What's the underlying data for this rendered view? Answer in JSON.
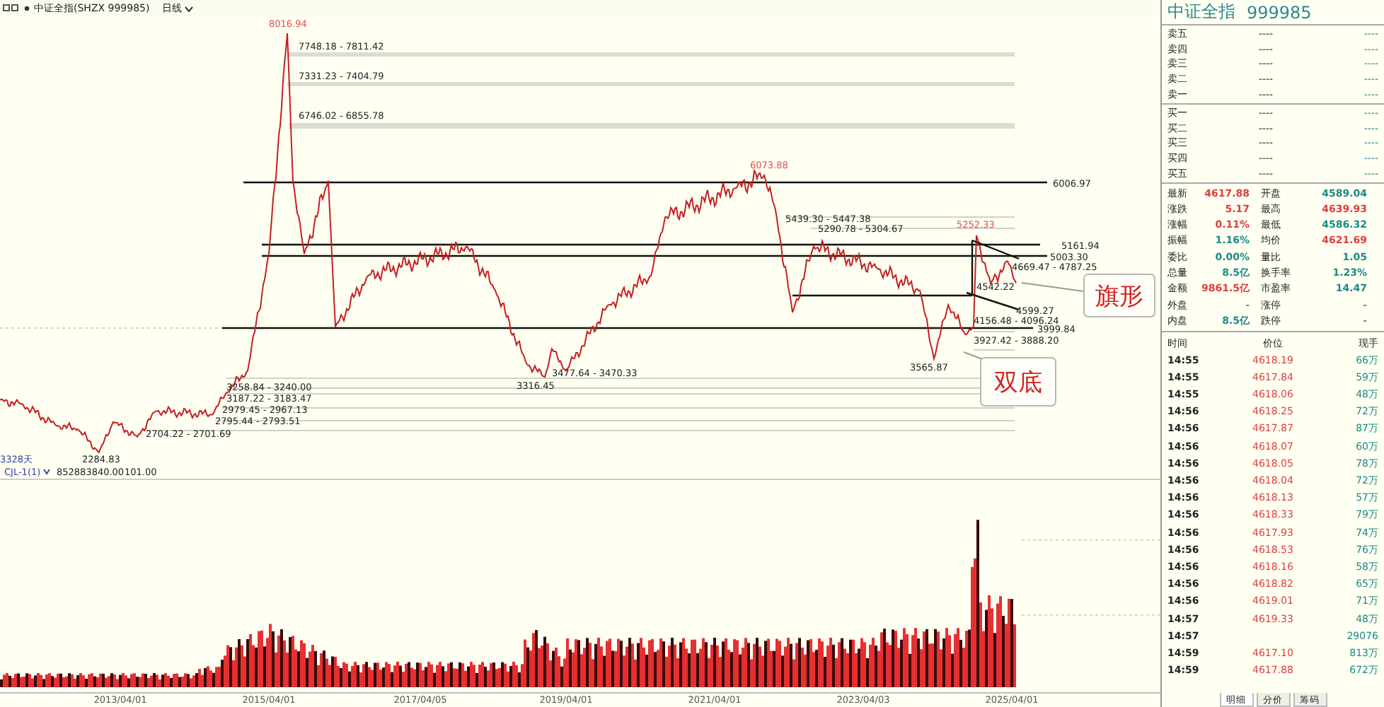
{
  "header": {
    "symbol": "中证全指(SHZX 999985)",
    "period": "日线"
  },
  "chart": {
    "peak_labels": [
      "8016.94",
      "6073.88",
      "5252.33"
    ],
    "low_labels": [
      "2284.83",
      "3316.45",
      "3565.87"
    ],
    "level_labels": [
      "6006.97",
      "5161.94",
      "5003.30",
      "3999.84"
    ],
    "zone_labels": [
      "7748.18 - 7811.42",
      "7331.23 - 7404.79",
      "6746.02 - 6855.78",
      "5439.30 - 5447.38",
      "5290.78 - 5304.67",
      "4669.47 - 4787.25",
      "4542.22",
      "4599.27",
      "4156.48 - 4096.24",
      "3927.42 - 3888.20",
      "3477.64 - 3470.33",
      "3258.84 - 3240.00",
      "3187.22 - 3183.47",
      "2979.45 - 2967.13",
      "2795.44 - 2793.51",
      "2704.22 - 2701.69"
    ],
    "callouts": [
      "旗形",
      "双底"
    ],
    "span_label": "3328天"
  },
  "volume": {
    "indicator": "CJL-1(1)",
    "value_1": "852883840.00",
    "value_2": "101.00"
  },
  "x_axis": [
    "2013/04/01",
    "2015/04/01",
    "2017/04/05",
    "2019/04/01",
    "2021/04/01",
    "2023/04/03",
    "2025/04/01"
  ],
  "quote": {
    "name": "中证全指",
    "code": "999985",
    "sell": [
      {
        "label": "卖五",
        "price": "----",
        "volume": "----"
      },
      {
        "label": "卖四",
        "price": "----",
        "volume": "----"
      },
      {
        "label": "卖三",
        "price": "----",
        "volume": "----"
      },
      {
        "label": "卖二",
        "price": "----",
        "volume": "----"
      },
      {
        "label": "卖一",
        "price": "----",
        "volume": "----"
      }
    ],
    "buy": [
      {
        "label": "买一",
        "price": "----",
        "volume": "----"
      },
      {
        "label": "买二",
        "price": "----",
        "volume": "----"
      },
      {
        "label": "买三",
        "price": "----",
        "volume": "----"
      },
      {
        "label": "买四",
        "price": "----",
        "volume": "----"
      },
      {
        "label": "买五",
        "price": "----",
        "volume": "----"
      }
    ],
    "stats": [
      {
        "label": "最新",
        "value": "4617.88",
        "color": "#e03c3c"
      },
      {
        "label": "开盘",
        "value": "4589.04",
        "color": "#1a8a8a"
      },
      {
        "label": "涨跌",
        "value": "5.17",
        "color": "#e03c3c"
      },
      {
        "label": "最高",
        "value": "4639.93",
        "color": "#e03c3c"
      },
      {
        "label": "涨幅",
        "value": "0.11%",
        "color": "#e03c3c"
      },
      {
        "label": "最低",
        "value": "4586.32",
        "color": "#1a8a8a"
      },
      {
        "label": "振幅",
        "value": "1.16%",
        "color": "#1a8a8a"
      },
      {
        "label": "均价",
        "value": "4621.69",
        "color": "#e03c3c"
      },
      {
        "label": "委比",
        "value": "0.00%",
        "color": "#1a8a8a"
      },
      {
        "label": "量比",
        "value": "1.05",
        "color": "#1a8a8a"
      },
      {
        "label": "总量",
        "value": "8.5亿",
        "color": "#1a8a8a"
      },
      {
        "label": "换手率",
        "value": "1.23%",
        "color": "#1a8a8a"
      },
      {
        "label": "金额",
        "value": "9861.5亿",
        "color": "#e03c3c"
      },
      {
        "label": "市盈率",
        "value": "14.47",
        "color": "#1a8a8a"
      },
      {
        "label": "外盘",
        "value": "-",
        "color": "#888888"
      },
      {
        "label": "涨停",
        "value": "-",
        "color": "#888888"
      },
      {
        "label": "内盘",
        "value": "8.5亿",
        "color": "#1a8a8a"
      },
      {
        "label": "跌停",
        "value": "-",
        "color": "#888888"
      }
    ],
    "tick_columns": [
      "时间",
      "价位",
      "现手"
    ],
    "ticks": [
      {
        "time": "14:55",
        "price": "4618.19",
        "volume": "66万"
      },
      {
        "time": "14:55",
        "price": "4617.84",
        "volume": "59万"
      },
      {
        "time": "14:55",
        "price": "4618.06",
        "volume": "48万"
      },
      {
        "time": "14:56",
        "price": "4618.25",
        "volume": "72万"
      },
      {
        "time": "14:56",
        "price": "4617.87",
        "volume": "87万"
      },
      {
        "time": "14:56",
        "price": "4618.07",
        "volume": "60万"
      },
      {
        "time": "14:56",
        "price": "4618.05",
        "volume": "78万"
      },
      {
        "time": "14:56",
        "price": "4618.04",
        "volume": "72万"
      },
      {
        "time": "14:56",
        "price": "4618.13",
        "volume": "57万"
      },
      {
        "time": "14:56",
        "price": "4618.33",
        "volume": "79万"
      },
      {
        "time": "14:56",
        "price": "4617.93",
        "volume": "74万"
      },
      {
        "time": "14:56",
        "price": "4618.53",
        "volume": "76万"
      },
      {
        "time": "14:56",
        "price": "4618.16",
        "volume": "58万"
      },
      {
        "time": "14:56",
        "price": "4618.82",
        "volume": "65万"
      },
      {
        "time": "14:56",
        "price": "4619.01",
        "volume": "71万"
      },
      {
        "time": "14:57",
        "price": "4619.33",
        "volume": "48万"
      },
      {
        "time": "14:57",
        "volume": "29076"
      },
      {
        "time": "14:59",
        "price": "4617.10",
        "volume": "813万"
      },
      {
        "time": "14:59",
        "price": "4617.88",
        "volume": "672万"
      }
    ],
    "tabs": [
      {
        "label": "明细",
        "selected": true
      },
      {
        "label": "分价",
        "selected": false
      },
      {
        "label": "筹码",
        "selected": false
      }
    ]
  }
}
